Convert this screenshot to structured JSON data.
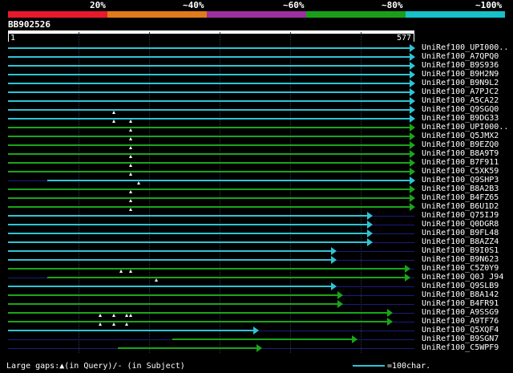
{
  "colors": {
    "cyan": "#2ec4d4",
    "green": "#1aa51a",
    "navy": "#1b1b80",
    "seg_red": "#e8192c",
    "seg_orange": "#e07a1a",
    "seg_purple": "#9e2fa0",
    "seg_green": "#1a9e1a",
    "seg_cyan": "#18c0c8"
  },
  "scale": {
    "labels": [
      "20%",
      "~40%",
      "~60%",
      "~80%",
      "~100%"
    ]
  },
  "query": {
    "name": "BB902526",
    "start": "1",
    "end": "577",
    "length": 577
  },
  "hits": [
    {
      "label": "UniRef100_UPI000..",
      "color": "cyan",
      "start": 0,
      "end": 577,
      "gaps": []
    },
    {
      "label": "UniRef100_A7QPQ0",
      "color": "cyan",
      "start": 0,
      "end": 577,
      "gaps": []
    },
    {
      "label": "UniRef100_B9S936",
      "color": "cyan",
      "start": 0,
      "end": 577,
      "gaps": []
    },
    {
      "label": "UniRef100_B9H2N9",
      "color": "cyan",
      "start": 0,
      "end": 577,
      "gaps": []
    },
    {
      "label": "UniRef100_B9N9L2",
      "color": "cyan",
      "start": 0,
      "end": 577,
      "gaps": []
    },
    {
      "label": "UniRef100_A7PJC2",
      "color": "cyan",
      "start": 0,
      "end": 577,
      "gaps": []
    },
    {
      "label": "UniRef100_A5CA22",
      "color": "cyan",
      "start": 0,
      "end": 577,
      "gaps": []
    },
    {
      "label": "UniRef100_Q9SGQ0",
      "color": "cyan",
      "start": 0,
      "end": 577,
      "gaps": [
        150
      ]
    },
    {
      "label": "UniRef100_B9DG33",
      "color": "cyan",
      "start": 0,
      "end": 577,
      "gaps": [
        150,
        174
      ]
    },
    {
      "label": "UniRef100_UPI000..",
      "color": "green",
      "start": 0,
      "end": 577,
      "gaps": [
        174
      ]
    },
    {
      "label": "UniRef100_Q5JMX2",
      "color": "green",
      "start": 0,
      "end": 577,
      "gaps": [
        174
      ]
    },
    {
      "label": "UniRef100_B9EZQ0",
      "color": "green",
      "start": 0,
      "end": 577,
      "gaps": [
        174
      ]
    },
    {
      "label": "UniRef100_B8A9T9",
      "color": "green",
      "start": 0,
      "end": 577,
      "gaps": [
        174
      ]
    },
    {
      "label": "UniRef100_B7F911",
      "color": "green",
      "start": 0,
      "end": 577,
      "gaps": [
        174
      ]
    },
    {
      "label": "UniRef100_C5XK59",
      "color": "green",
      "start": 0,
      "end": 577,
      "gaps": [
        174
      ]
    },
    {
      "label": "UniRef100_Q9SHP3",
      "color": "cyan",
      "start": 56,
      "end": 577,
      "gaps": [
        185
      ]
    },
    {
      "label": "UniRef100_B8A2B3",
      "color": "green",
      "start": 0,
      "end": 577,
      "gaps": [
        174
      ]
    },
    {
      "label": "UniRef100_B4FZ65",
      "color": "green",
      "start": 0,
      "end": 577,
      "gaps": [
        174
      ]
    },
    {
      "label": "UniRef100_B6U1D2",
      "color": "green",
      "start": 0,
      "end": 577,
      "gaps": [
        174
      ]
    },
    {
      "label": "UniRef100_Q75IJ9",
      "color": "cyan",
      "start": 0,
      "end": 517,
      "gaps": []
    },
    {
      "label": "UniRef100_Q0DGR8",
      "color": "cyan",
      "start": 0,
      "end": 517,
      "gaps": []
    },
    {
      "label": "UniRef100_B9FL48",
      "color": "cyan",
      "start": 0,
      "end": 517,
      "gaps": []
    },
    {
      "label": "UniRef100_B8AZZ4",
      "color": "cyan",
      "start": 0,
      "end": 517,
      "gaps": []
    },
    {
      "label": "UniRef100_B9I0S1",
      "color": "cyan",
      "start": 0,
      "end": 465,
      "gaps": []
    },
    {
      "label": "UniRef100_B9N623",
      "color": "cyan",
      "start": 0,
      "end": 465,
      "gaps": []
    },
    {
      "label": "UniRef100_C5Z0Y9",
      "color": "green",
      "start": 0,
      "end": 570,
      "gaps": [
        161,
        174
      ]
    },
    {
      "label": "UniRef100_Q0J J94",
      "color": "green",
      "start": 56,
      "end": 570,
      "gaps": [
        210
      ]
    },
    {
      "label": "UniRef100_Q9SLB9",
      "color": "cyan",
      "start": 0,
      "end": 465,
      "gaps": []
    },
    {
      "label": "UniRef100_B8A142",
      "color": "green",
      "start": 0,
      "end": 475,
      "gaps": []
    },
    {
      "label": "UniRef100_B4FR91",
      "color": "green",
      "start": 0,
      "end": 475,
      "gaps": []
    },
    {
      "label": "UniRef100_A9SSG9",
      "color": "green",
      "start": 0,
      "end": 545,
      "gaps": [
        131,
        150,
        168,
        174
      ]
    },
    {
      "label": "UniRef100_A9TF76",
      "color": "green",
      "start": 0,
      "end": 545,
      "gaps": [
        131,
        150,
        168
      ]
    },
    {
      "label": "UniRef100_Q5XQF4",
      "color": "cyan",
      "start": 0,
      "end": 355,
      "gaps": []
    },
    {
      "label": "UniRef100_B9SGN7",
      "color": "green",
      "start": 233,
      "end": 495,
      "gaps": []
    },
    {
      "label": "UniRef100_C5WPF9",
      "color": "green",
      "start": 156,
      "end": 360,
      "gaps": []
    }
  ],
  "footer": {
    "gaps_text": "Large gaps:▲(in Query)/- (in Subject)",
    "legend_text": "=100char."
  }
}
